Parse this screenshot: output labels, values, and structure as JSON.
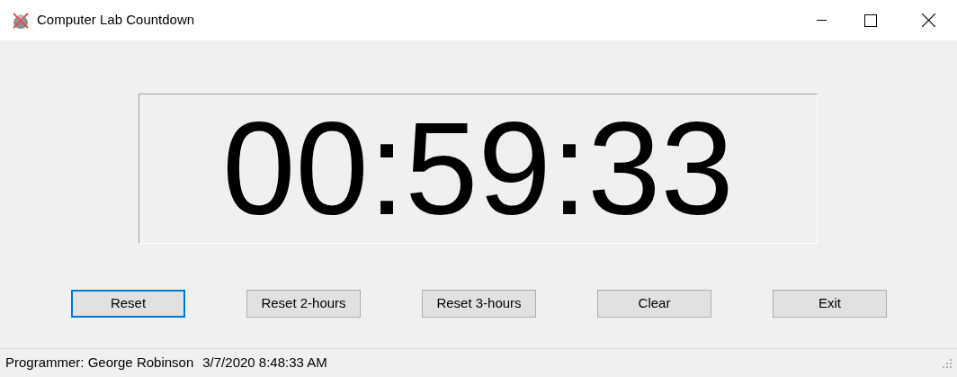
{
  "window": {
    "title": "Computer Lab Countdown"
  },
  "timer": {
    "text": "00:59:33"
  },
  "buttons": [
    {
      "label": "Reset",
      "focused": true
    },
    {
      "label": "Reset 2-hours",
      "focused": false
    },
    {
      "label": "Reset 3-hours",
      "focused": false
    },
    {
      "label": "Clear",
      "focused": false
    },
    {
      "label": "Exit",
      "focused": false
    }
  ],
  "status_bar": {
    "programmer": "Programmer: George Robinson",
    "datetime": "3/7/2020 8:48:33 AM"
  }
}
